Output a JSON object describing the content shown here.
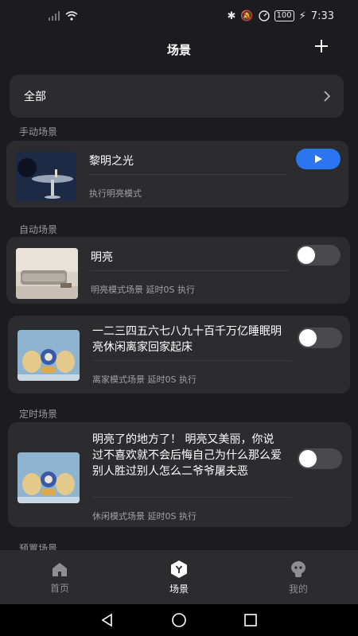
{
  "status": {
    "time": "7:33",
    "battery": "100"
  },
  "header": {
    "title": "场景"
  },
  "all": {
    "label": "全部"
  },
  "sections": {
    "manual": "手动场景",
    "auto": "自动场景",
    "timed": "定时场景",
    "preset": "预置场景"
  },
  "cards": [
    {
      "title": "黎明之光",
      "subtitle": "执行明亮模式",
      "control": "play-icon"
    },
    {
      "title": "明亮",
      "subtitle": "明亮模式场景  延时0S 执行",
      "control": "toggle",
      "on": false
    },
    {
      "title": "一二三四五六七八九十百千万亿睡眠明亮休闲离家回家起床",
      "subtitle": "离家模式场景  延时0S 执行",
      "control": "toggle",
      "on": false
    },
    {
      "title": "明亮了的地方了！ 明亮又美丽，你说过不喜欢就不会后悔自己为什么那么爱别人胜过别人怎么二爷爷屠夫恶",
      "subtitle": "休闲模式场景  延时0S 执行",
      "control": "toggle",
      "on": false
    }
  ],
  "tabs": [
    {
      "label": "首页",
      "icon": "home-icon"
    },
    {
      "label": "场景",
      "icon": "scene-icon"
    },
    {
      "label": "我的",
      "icon": "profile-icon"
    }
  ],
  "colors": {
    "accent": "#2b76f0",
    "background": "#1c1c1e",
    "card": "#2c2c2e"
  }
}
